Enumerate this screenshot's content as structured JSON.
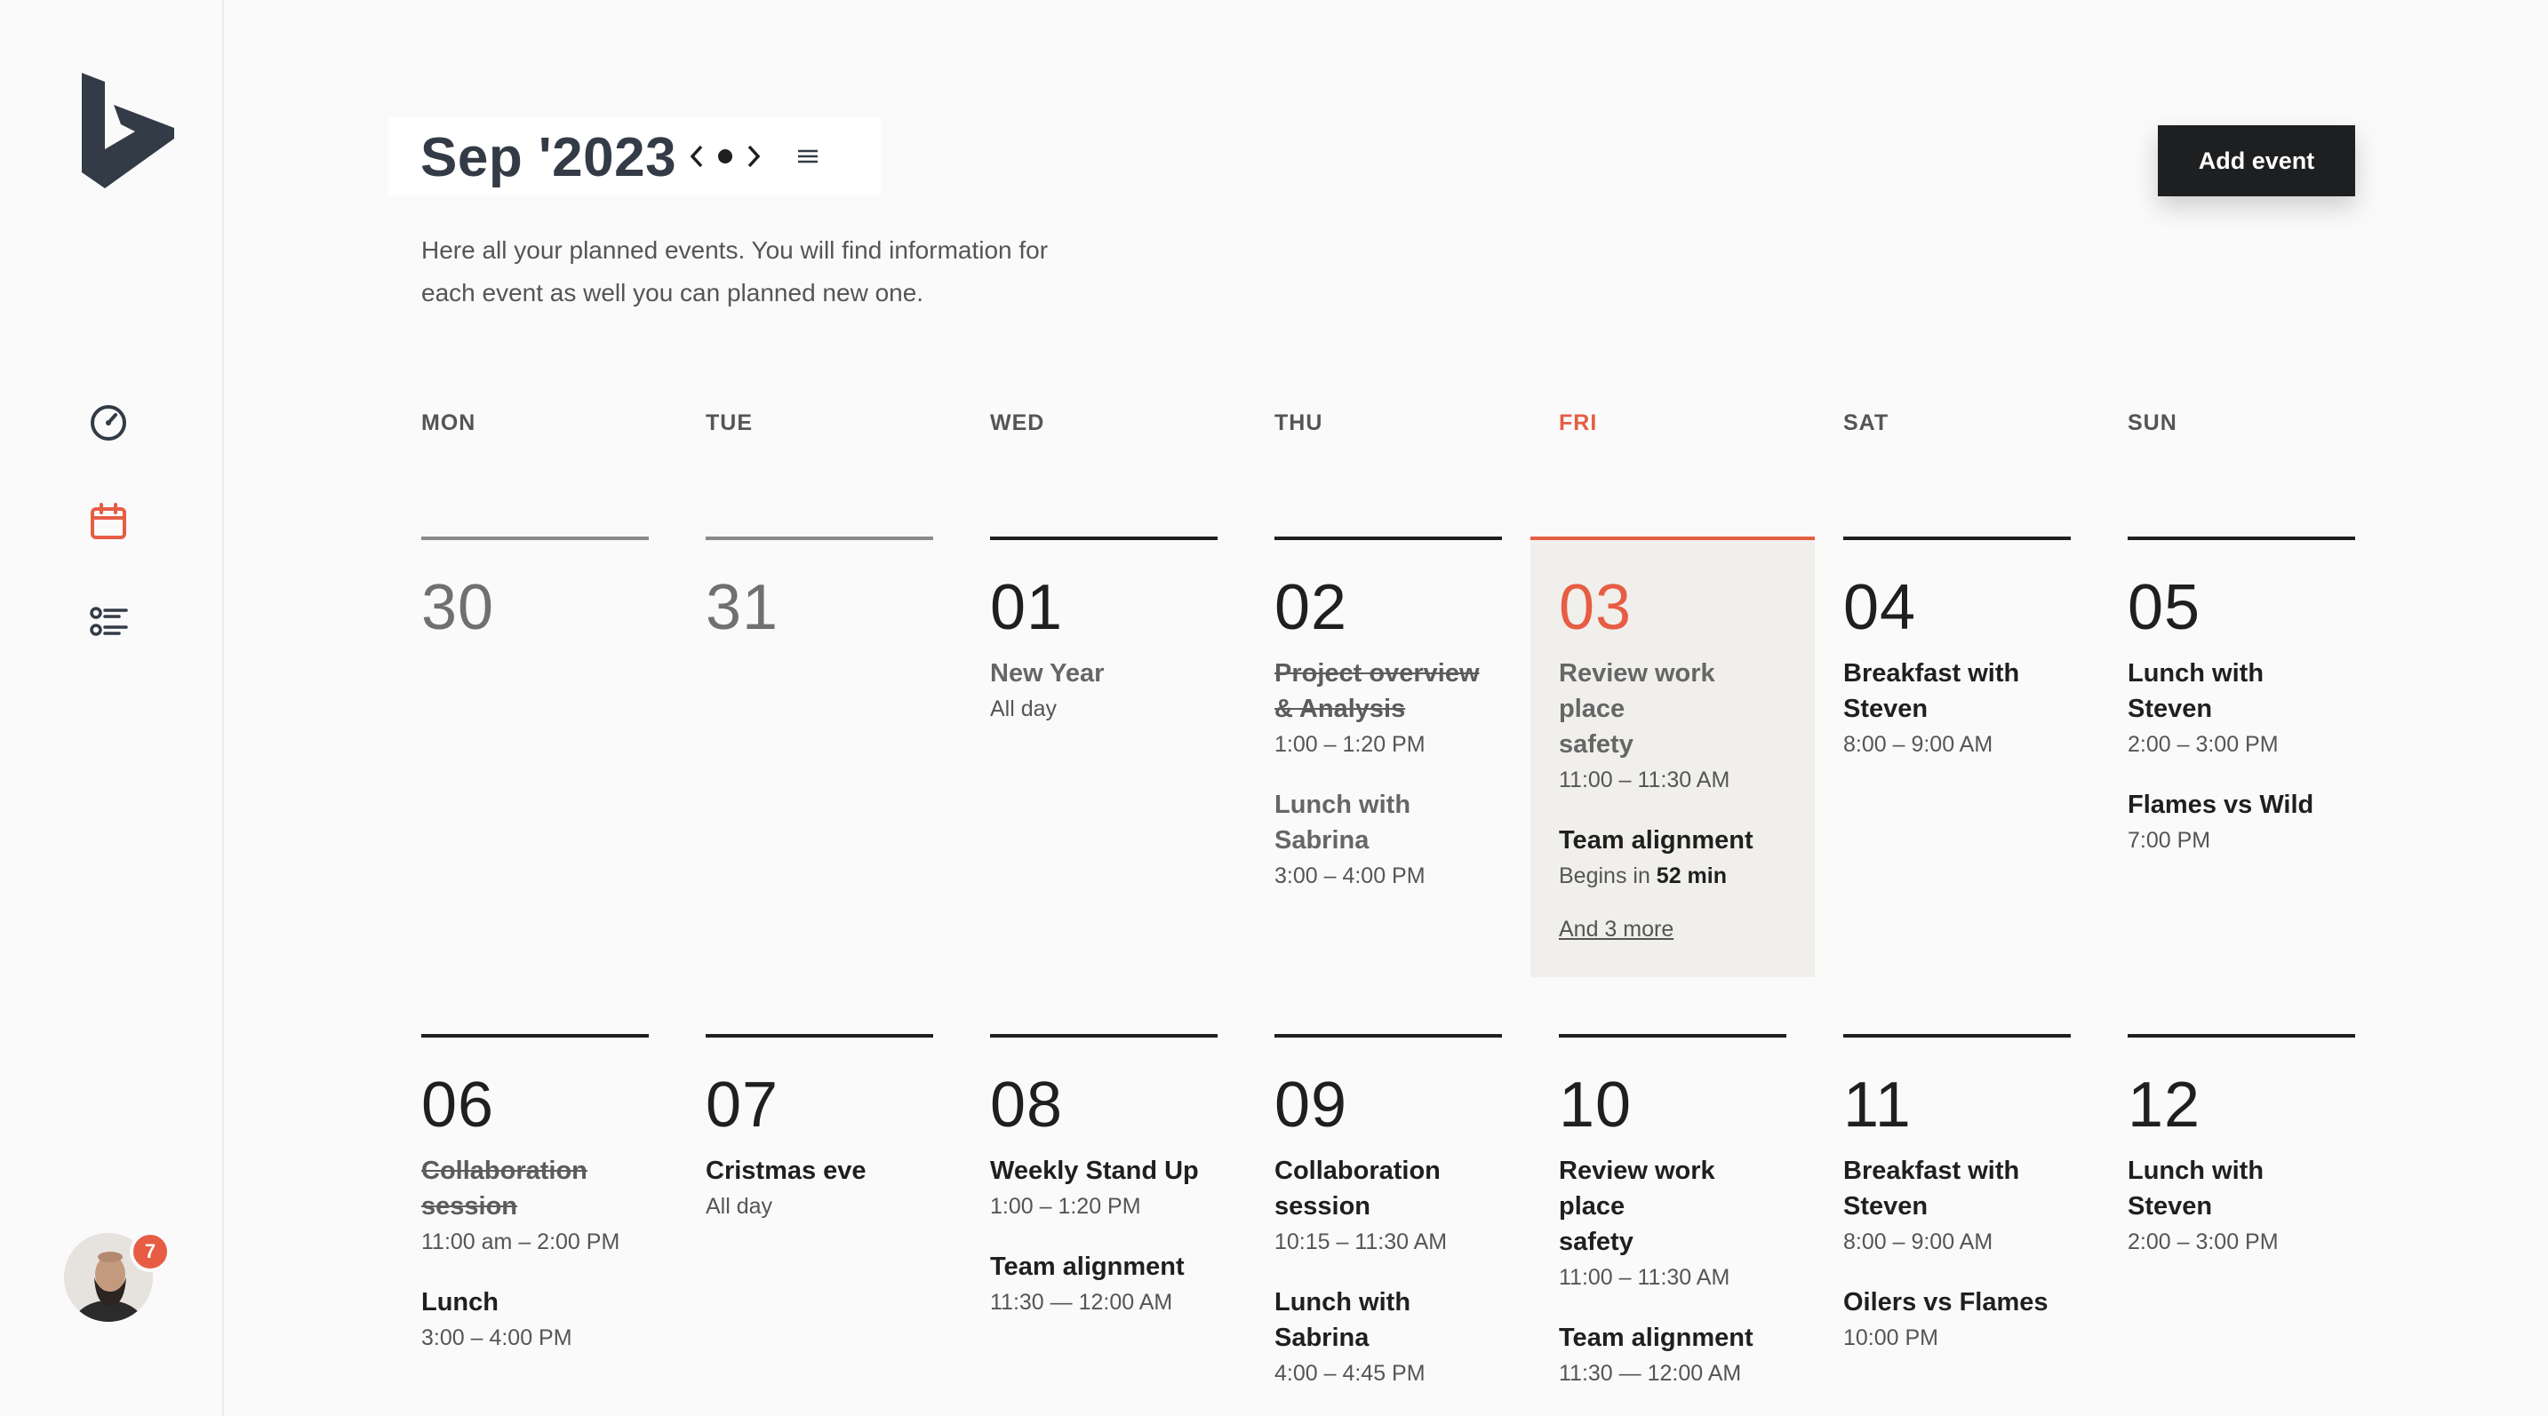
{
  "header": {
    "month": "Sep '2023",
    "subtitle_line1": "Here all your planned events. You will find information for",
    "subtitle_line2": "each event as well you can planned new one.",
    "add_event_label": "Add event"
  },
  "sidebar": {
    "items": [
      {
        "name": "dashboard",
        "icon": "speedometer-icon"
      },
      {
        "name": "calendar",
        "icon": "calendar-icon",
        "active": true
      },
      {
        "name": "list",
        "icon": "list-icon"
      }
    ],
    "notifications": "7"
  },
  "colors": {
    "accent": "#e65d44",
    "dark": "#1e1f20",
    "today_bg": "#f0efec"
  },
  "weekdays": [
    "MON",
    "TUE",
    "WED",
    "THU",
    "FRI",
    "SAT",
    "SUN"
  ],
  "week1": {
    "mon": {
      "num": "30"
    },
    "tue": {
      "num": "31"
    },
    "wed": {
      "num": "01",
      "e1_title": "New Year",
      "e1_time": "All day"
    },
    "thu": {
      "num": "02",
      "e1_title_a": "Project overview",
      "e1_title_b": "& Analysis",
      "e1_time": "1:00 – 1:20 PM",
      "e2_title_a": "Lunch with",
      "e2_title_b": "Sabrina",
      "e2_time": "3:00 – 4:00 PM"
    },
    "fri": {
      "num": "03",
      "e1_title_a": "Review work place",
      "e1_title_b": "safety",
      "e1_time": "11:00 – 11:30 AM",
      "e2_title": "Team alignment",
      "e2_time_prefix": "Begins in ",
      "e2_time_value": "52 min",
      "more": "And 3 more"
    },
    "sat": {
      "num": "04",
      "e1_title_a": "Breakfast with",
      "e1_title_b": "Steven",
      "e1_time": "8:00 – 9:00 AM"
    },
    "sun": {
      "num": "05",
      "e1_title": "Lunch with Steven",
      "e1_time": "2:00 – 3:00 PM",
      "e2_title": "Flames vs Wild",
      "e2_time": "7:00 PM"
    }
  },
  "week2": {
    "mon": {
      "num": "06",
      "e1_title_a": "Collaboration",
      "e1_title_b": "session",
      "e1_time": "11:00 am – 2:00 PM",
      "e2_title": "Lunch",
      "e2_time": "3:00 – 4:00 PM"
    },
    "tue": {
      "num": "07",
      "e1_title": "Cristmas eve",
      "e1_time": "All day"
    },
    "wed": {
      "num": "08",
      "e1_title": "Weekly Stand Up",
      "e1_time": "1:00 – 1:20 PM",
      "e2_title": "Team alignment",
      "e2_time": "11:30 — 12:00 AM"
    },
    "thu": {
      "num": "09",
      "e1_title_a": "Collaboration",
      "e1_title_b": "session",
      "e1_time": "10:15 – 11:30 AM",
      "e2_title_a": "Lunch with",
      "e2_title_b": "Sabrina",
      "e2_time": "4:00 – 4:45 PM"
    },
    "fri": {
      "num": "10",
      "e1_title_a": "Review work place",
      "e1_title_b": "safety",
      "e1_time": "11:00 – 11:30 AM",
      "e2_title": "Team alignment",
      "e2_time": "11:30 — 12:00 AM"
    },
    "sat": {
      "num": "11",
      "e1_title_a": "Breakfast with",
      "e1_title_b": "Steven",
      "e1_time": "8:00 – 9:00 AM",
      "e2_title": "Oilers vs Flames",
      "e2_time": "10:00 PM"
    },
    "sun": {
      "num": "12",
      "e1_title": "Lunch with Steven",
      "e1_time": "2:00 – 3:00 PM"
    }
  }
}
